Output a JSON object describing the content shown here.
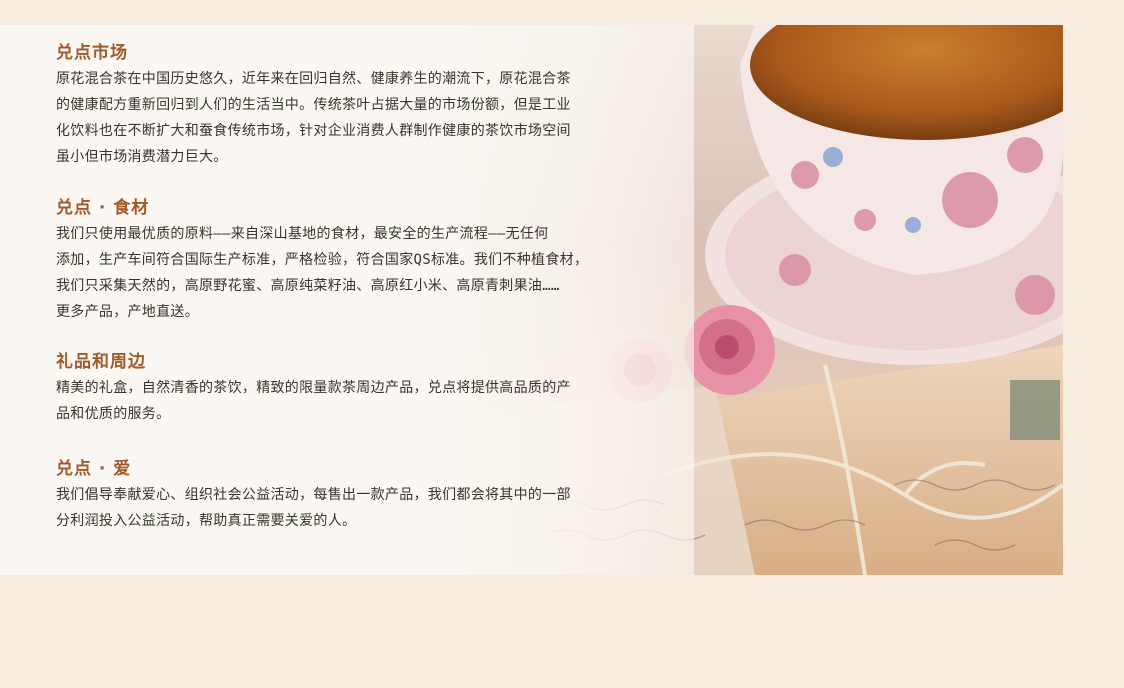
{
  "sections": [
    {
      "title": "兑点市场",
      "lines": [
        "原花混合茶在中国历史悠久，近年来在回归自然、健康养生的潮流下，原花混合茶",
        "的健康配方重新回归到人们的生活当中。传统茶叶占据大量的市场份额，但是工业",
        "化饮料也在不断扩大和蚕食传统市场，针对企业消费人群制作健康的茶饮市场空间",
        "虽小但市场消费潜力巨大。"
      ]
    },
    {
      "title": "兑点 · 食材",
      "lines": [
        "我们只使用最优质的原料——来自深山基地的食材，最安全的生产流程——无任何",
        "添加，生产车间符合国际生产标准，严格检验，符合国家QS标准。我们不种植食材，",
        "我们只采集天然的，高原野花蜜、高原纯菜籽油、高原红小米、高原青刺果油……",
        "更多产品，产地直送。"
      ]
    },
    {
      "title": "礼品和周边",
      "lines": [
        "精美的礼盒，自然清香的茶饮，精致的限量款茶周边产品，兑点将提供高品质的产",
        "品和优质的服务。"
      ]
    },
    {
      "title": "兑点 · 爱",
      "lines": [
        "我们倡导奉献爱心、组织社会公益活动，每售出一款产品，我们都会将其中的一部",
        "分利润投入公益活动，帮助真正需要关爱的人。"
      ]
    }
  ],
  "image": {
    "subject": "tea-cup-roses-postcard-photo",
    "colors": {
      "tea": "#b5651d",
      "cup": "#f3e6e2",
      "rose": "#e59aaa",
      "paper": "#e8c9a8",
      "string": "#efe3cc"
    }
  }
}
